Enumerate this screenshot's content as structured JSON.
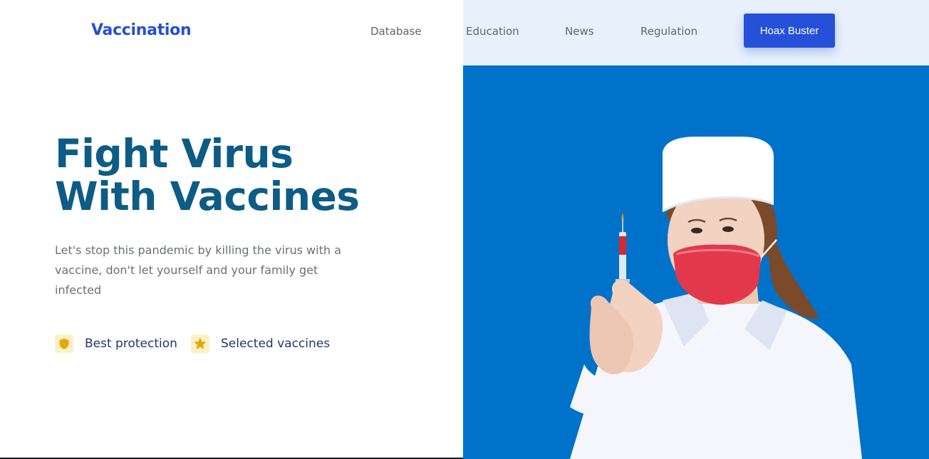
{
  "header": {
    "logo": "Vaccination",
    "nav": [
      "Database",
      "Education",
      "News",
      "Regulation"
    ],
    "cta_label": "Hoax Buster"
  },
  "hero": {
    "title_line1": "Fight Virus",
    "title_line2": "With Vaccines",
    "description": "Let's stop this pandemic by killing the virus with a vaccine, don't let yourself and your family get infected",
    "features": [
      {
        "icon": "shield-icon",
        "label": "Best protection"
      },
      {
        "icon": "star-icon",
        "label": "Selected vaccines"
      }
    ],
    "image": "nurse-with-syringe"
  },
  "colors": {
    "brand": "#2550d0",
    "title": "#0d5c85",
    "hero_bg": "#0072ca",
    "nav_bg_right": "#e8f1fb",
    "feature_icon": "#e3b20c"
  }
}
